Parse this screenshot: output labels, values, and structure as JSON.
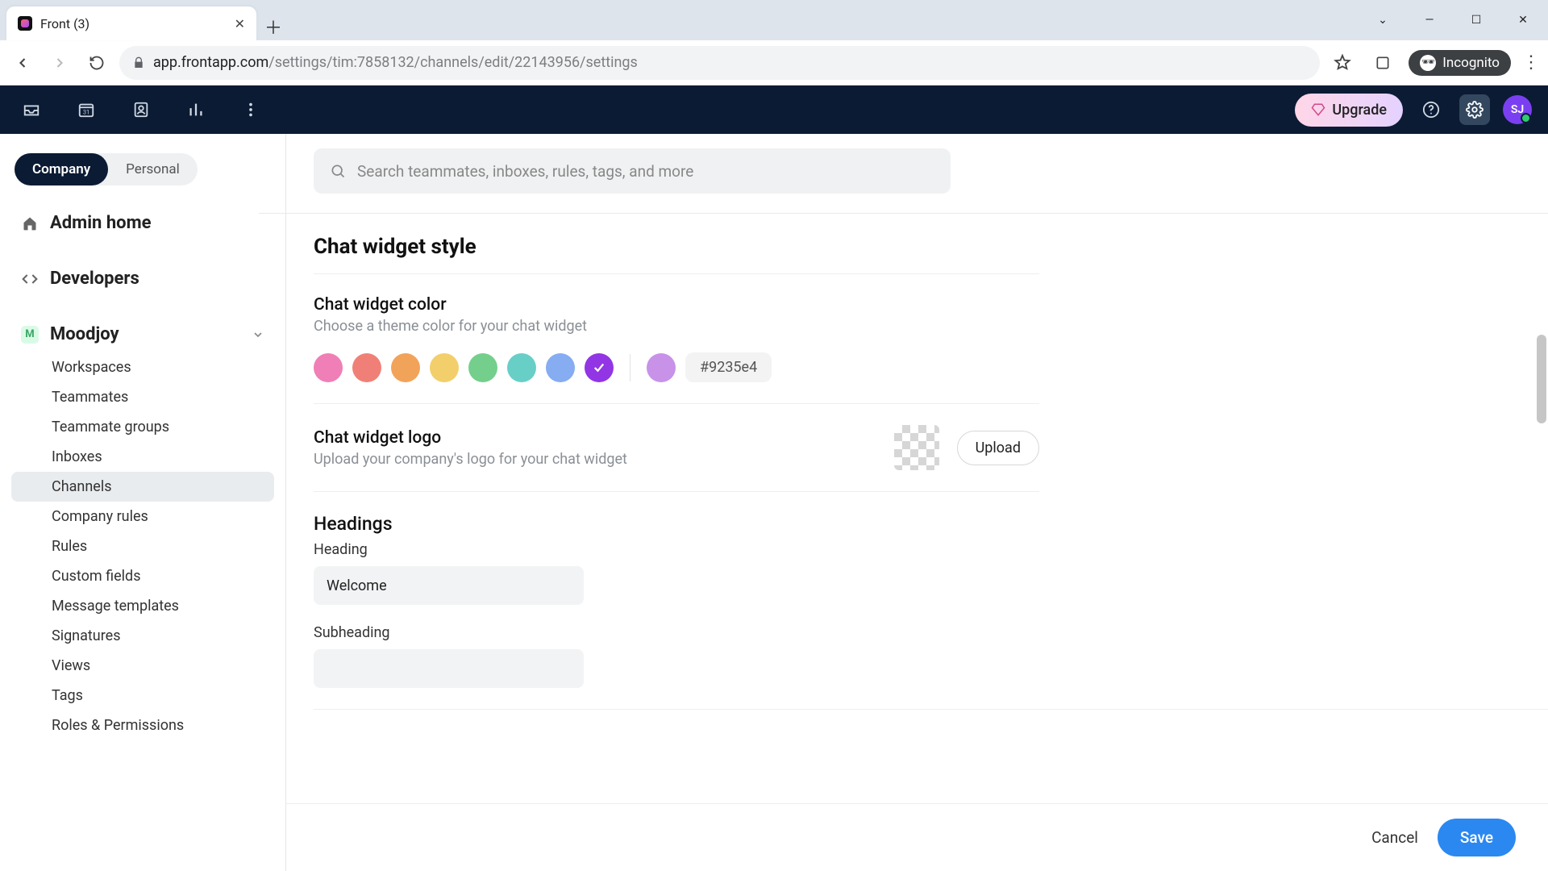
{
  "browser": {
    "tab_title": "Front (3)",
    "url_domain": "app.frontapp.com",
    "url_path": "/settings/tim:7858132/channels/edit/22143956/settings",
    "incognito_label": "Incognito"
  },
  "header": {
    "upgrade_label": "Upgrade",
    "avatar_initials": "SJ"
  },
  "sidebar": {
    "toggle": {
      "company": "Company",
      "personal": "Personal"
    },
    "admin_home": "Admin home",
    "developers": "Developers",
    "org_name": "Moodjoy",
    "items": [
      "Workspaces",
      "Teammates",
      "Teammate groups",
      "Inboxes",
      "Channels",
      "Company rules",
      "Rules",
      "Custom fields",
      "Message templates",
      "Signatures",
      "Views",
      "Tags",
      "Roles & Permissions"
    ],
    "active_index": 4
  },
  "search": {
    "placeholder": "Search teammates, inboxes, rules, tags, and more"
  },
  "page": {
    "title": "Chat widget style",
    "color_section": {
      "title": "Chat widget color",
      "subtitle": "Choose a theme color for your chat widget",
      "swatches": [
        "#ef7fb6",
        "#f08077",
        "#f2a35a",
        "#f2cf6b",
        "#74cf8c",
        "#68cfc7",
        "#86acf2",
        "#9235e4"
      ],
      "extra_swatch": "#c792e8",
      "selected_index": 7,
      "hex_value": "#9235e4"
    },
    "logo_section": {
      "title": "Chat widget logo",
      "subtitle": "Upload your company's logo for your chat widget",
      "upload_label": "Upload"
    },
    "headings_section": {
      "title": "Headings",
      "heading_label": "Heading",
      "heading_value": "Welcome",
      "subheading_label": "Subheading",
      "subheading_value": ""
    },
    "footer": {
      "cancel": "Cancel",
      "save": "Save"
    }
  }
}
